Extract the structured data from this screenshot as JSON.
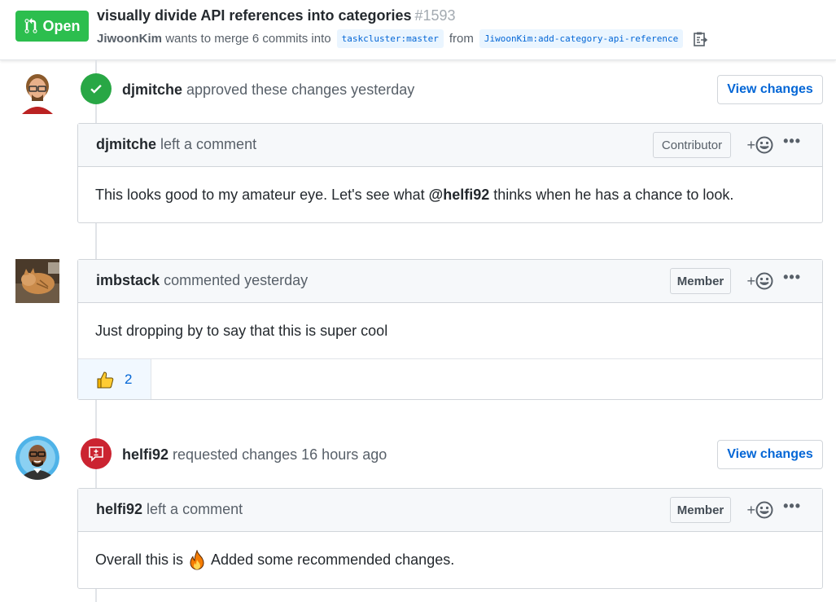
{
  "pr": {
    "state": "Open",
    "title": "visually divide API references into categories",
    "number": "#1593",
    "author": "JiwoonKim",
    "merge_text": "wants to merge 6 commits into",
    "base_branch": "taskcluster:master",
    "from_text": "from",
    "head_branch": "JiwoonKim:add-category-api-reference"
  },
  "timeline": {
    "review1": {
      "user": "djmitche",
      "action": "approved these changes yesterday",
      "view_changes": "View changes",
      "comment": {
        "user": "djmitche",
        "action": "left a comment",
        "role": "Contributor",
        "body_before": "This looks good to my amateur eye. Let's see what",
        "mention": "@helfi92",
        "body_after": "thinks when he has a chance to look."
      }
    },
    "comment2": {
      "user": "imbstack",
      "action": "commented yesterday",
      "role": "Member",
      "body": "Just dropping by to say that this is super cool",
      "reaction_count": "2"
    },
    "review2": {
      "user": "helfi92",
      "action": "requested changes 16 hours ago",
      "view_changes": "View changes",
      "comment": {
        "user": "helfi92",
        "action": "left a comment",
        "role": "Member",
        "body_before": "Overall this is",
        "body_after": "Added some recommended changes."
      }
    }
  },
  "colors": {
    "open_green": "#2cbe4e",
    "approve_green": "#28a745",
    "request_red": "#cb2431",
    "link_blue": "#0366d6"
  },
  "icons": [
    "git-pull-request-icon",
    "clipboard-icon",
    "check-icon",
    "request-changes-icon",
    "smiley-icon",
    "kebab-icon",
    "thumbs-up-icon",
    "fire-icon"
  ]
}
